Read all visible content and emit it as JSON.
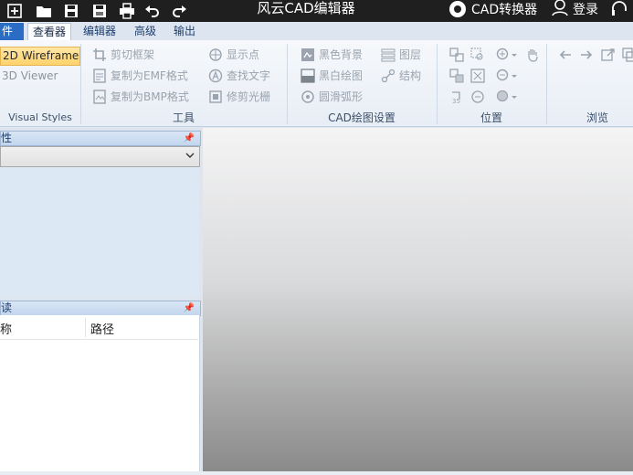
{
  "window": {
    "title": "风云CAD编辑器",
    "converter_label": "CAD转换器",
    "login_label": "登录"
  },
  "tabs": [
    {
      "label": "件"
    },
    {
      "label": "查看器"
    },
    {
      "label": "编辑器"
    },
    {
      "label": "高级"
    },
    {
      "label": "输出"
    }
  ],
  "ribbon": {
    "visual_styles": {
      "items": [
        "2D Wireframe",
        "3D Viewer"
      ],
      "group_label": "Visual Styles"
    },
    "tools": {
      "group_label": "工具",
      "items": [
        "剪切框架",
        "复制为EMF格式",
        "复制为BMP格式",
        "显示点",
        "查找文字",
        "修剪光栅"
      ]
    },
    "cad_settings": {
      "group_label": "CAD绘图设置",
      "items": [
        "黑色背景",
        "黑白绘图",
        "圆滑弧形",
        "图层",
        "结构"
      ]
    },
    "position": {
      "group_label": "位置"
    },
    "browse": {
      "group_label": "浏览"
    }
  },
  "left_panel_top": {
    "title": "性"
  },
  "left_panel_bottom": {
    "title": "读",
    "columns": [
      "称",
      "路径"
    ]
  },
  "colors": {
    "accent": "#2b6cc4",
    "titlebar": "#1f1f1f",
    "selected": "#ffd26b"
  }
}
